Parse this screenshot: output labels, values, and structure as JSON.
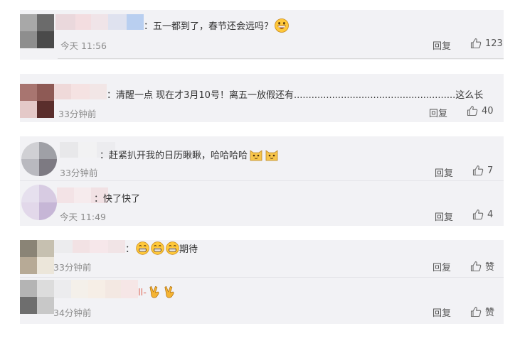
{
  "comments": [
    {
      "text": "：五一都到了，春节还会远吗？",
      "time": "今天 11:56",
      "reply_label": "回复",
      "like_count": "123",
      "emoji": [
        "grin-emoji"
      ]
    },
    {
      "text": "：清醒一点 现在才3月10号！离五一放假还有.......................................................这么长",
      "time": "33分钟前",
      "reply_label": "回复",
      "like_count": "40"
    },
    {
      "text": "：赶紧扒开我的日历瞅瞅，哈哈哈哈",
      "time": "33分钟前",
      "reply_label": "回复",
      "like_count": "7",
      "emoji": [
        "cat-emoji",
        "cat-emoji"
      ]
    },
    {
      "text": "：快了快了",
      "time": "今天 11:49",
      "reply_label": "回复",
      "like_count": "4"
    },
    {
      "text_prefix": "：",
      "text_suffix": "期待",
      "time": "33分钟前",
      "reply_label": "回复",
      "like_count": "赞",
      "emoji": [
        "grin-emoji",
        "grin-emoji",
        "grin-emoji"
      ]
    },
    {
      "text": "ll-",
      "time": "34分钟前",
      "reply_label": "回复",
      "like_count": "赞",
      "emoji": [
        "victory-hand-emoji",
        "victory-hand-emoji"
      ]
    }
  ],
  "colors": {
    "card_bg": "#f2f2f5",
    "emoji_yellow": "#ffc83a",
    "time_gray": "#8c8c8c"
  }
}
